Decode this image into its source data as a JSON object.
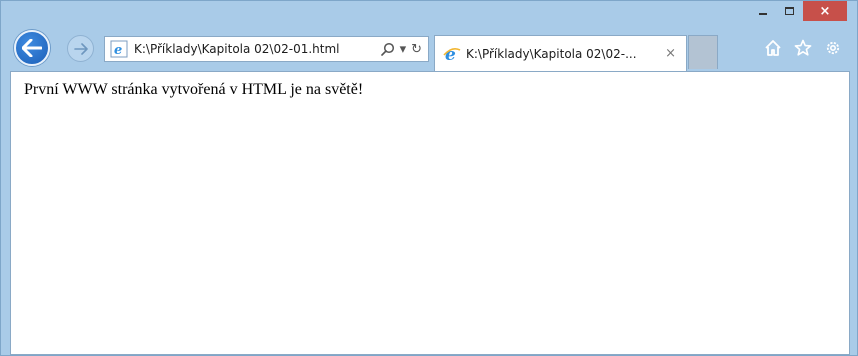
{
  "window": {
    "controls": {
      "minimize": "minimize",
      "maximize": "maximize",
      "close": "×"
    }
  },
  "nav": {
    "address_url": "K:\\Příklady\\Kapitola 02\\02-01.html",
    "address_tools": {
      "search": "search-icon",
      "dropdown": "▾",
      "refresh": "↻"
    }
  },
  "tab": {
    "title": "K:\\Příklady\\Kapitola 02\\02-...",
    "close": "×"
  },
  "toolbar_icons": [
    "home-icon",
    "star-icon",
    "gear-icon"
  ],
  "page": {
    "body_text": "První WWW stránka vytvořená v HTML je na světě!"
  },
  "colors": {
    "frame": "#a9cbe8",
    "close_button": "#c7504a",
    "back_button": "#1b5fb8",
    "ie_logo": "#2f8fe0"
  }
}
